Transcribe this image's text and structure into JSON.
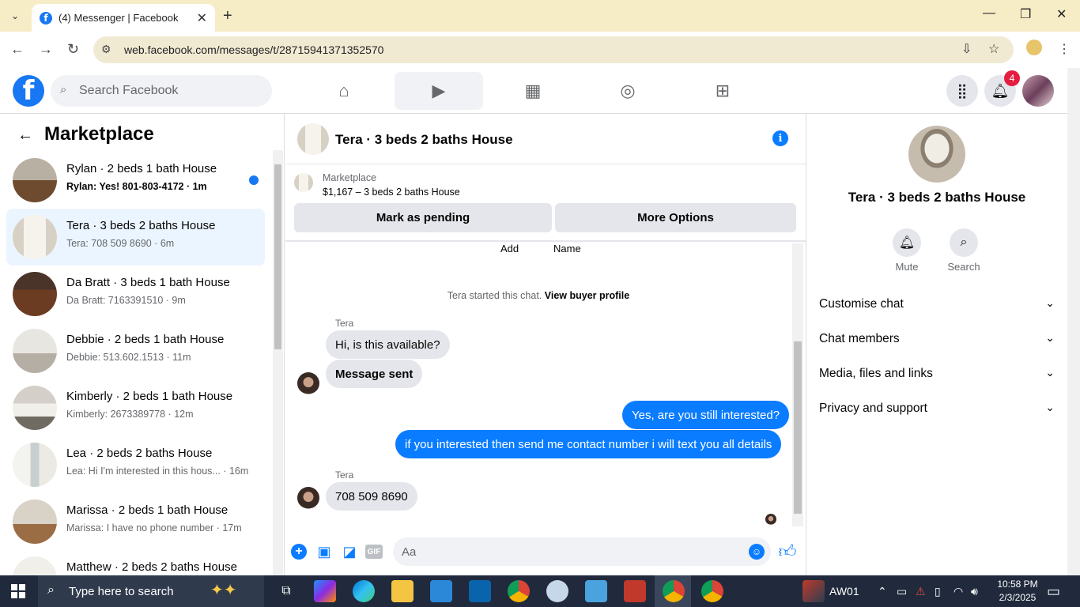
{
  "browser": {
    "tab_title": "(4) Messenger | Facebook",
    "url": "web.facebook.com/messages/t/28715941371352570"
  },
  "fb_header": {
    "search_placeholder": "Search Facebook",
    "notification_count": "4"
  },
  "marketplace": {
    "title": "Marketplace",
    "conversations": [
      {
        "name": "Rylan · 2 beds 1 bath House",
        "preview": "Rylan: Yes! 801-803-4172 · 1m",
        "unread": true,
        "active": false,
        "thumb": "ph-house1"
      },
      {
        "name": "Tera · 3 beds 2 baths House",
        "preview": "Tera: 708 509 8690 · 6m",
        "unread": false,
        "active": true,
        "thumb": "ph-window"
      },
      {
        "name": "Da Bratt · 3 beds 1 bath House",
        "preview": "Da Bratt: 7163391510 · 9m",
        "unread": false,
        "active": false,
        "thumb": "ph-dark"
      },
      {
        "name": "Debbie · 2 beds 1 bath House",
        "preview": "Debbie: 513.602.1513 · 11m",
        "unread": false,
        "active": false,
        "thumb": "ph-fan"
      },
      {
        "name": "Kimberly · 2 beds 1 bath House",
        "preview": "Kimberly: 2673389778 · 12m",
        "unread": false,
        "active": false,
        "thumb": "ph-bed"
      },
      {
        "name": "Lea · 2 beds 2 baths House",
        "preview": "Lea: Hi I'm interested in this hous... · 16m",
        "unread": false,
        "active": false,
        "thumb": "ph-bright"
      },
      {
        "name": "Marissa · 2 beds 1 bath House",
        "preview": "Marissa: I have no phone number · 17m",
        "unread": false,
        "active": false,
        "thumb": "ph-floor"
      },
      {
        "name": "Matthew · 2 beds 2 baths House",
        "preview": "",
        "unread": false,
        "active": false,
        "thumb": "ph-light"
      }
    ]
  },
  "chat": {
    "title": "Tera · 3 beds 2 baths House",
    "listing_source": "Marketplace",
    "listing_price": "$1,167 – 3 beds 2 baths House",
    "mark_pending_label": "Mark as pending",
    "more_options_label": "More Options",
    "add_label": "Add",
    "name_label": "Name",
    "started_text": "Tera started this chat.",
    "view_profile_link": "View buyer profile",
    "sender": "Tera",
    "messages": {
      "in1": "Hi, is this available?",
      "in2": "Message sent",
      "out1": "Yes, are you still interested?",
      "out2": "if you interested then send me contact number i will text you all details",
      "in3": "708 509 8690"
    },
    "composer_placeholder": "Aa",
    "gif_label": "GIF"
  },
  "info_panel": {
    "title": "Tera · 3 beds 2 baths House",
    "mute_label": "Mute",
    "search_label": "Search",
    "sections": [
      "Customise chat",
      "Chat members",
      "Media, files and links",
      "Privacy and support"
    ]
  },
  "taskbar": {
    "search_placeholder": "Type here to search",
    "stock_label": "AW01",
    "time": "10:58 PM",
    "date": "2/3/2025"
  },
  "colors": {
    "fb_blue": "#1877f2",
    "messenger_blue": "#0a7cff",
    "badge_red": "#e41e3f"
  }
}
